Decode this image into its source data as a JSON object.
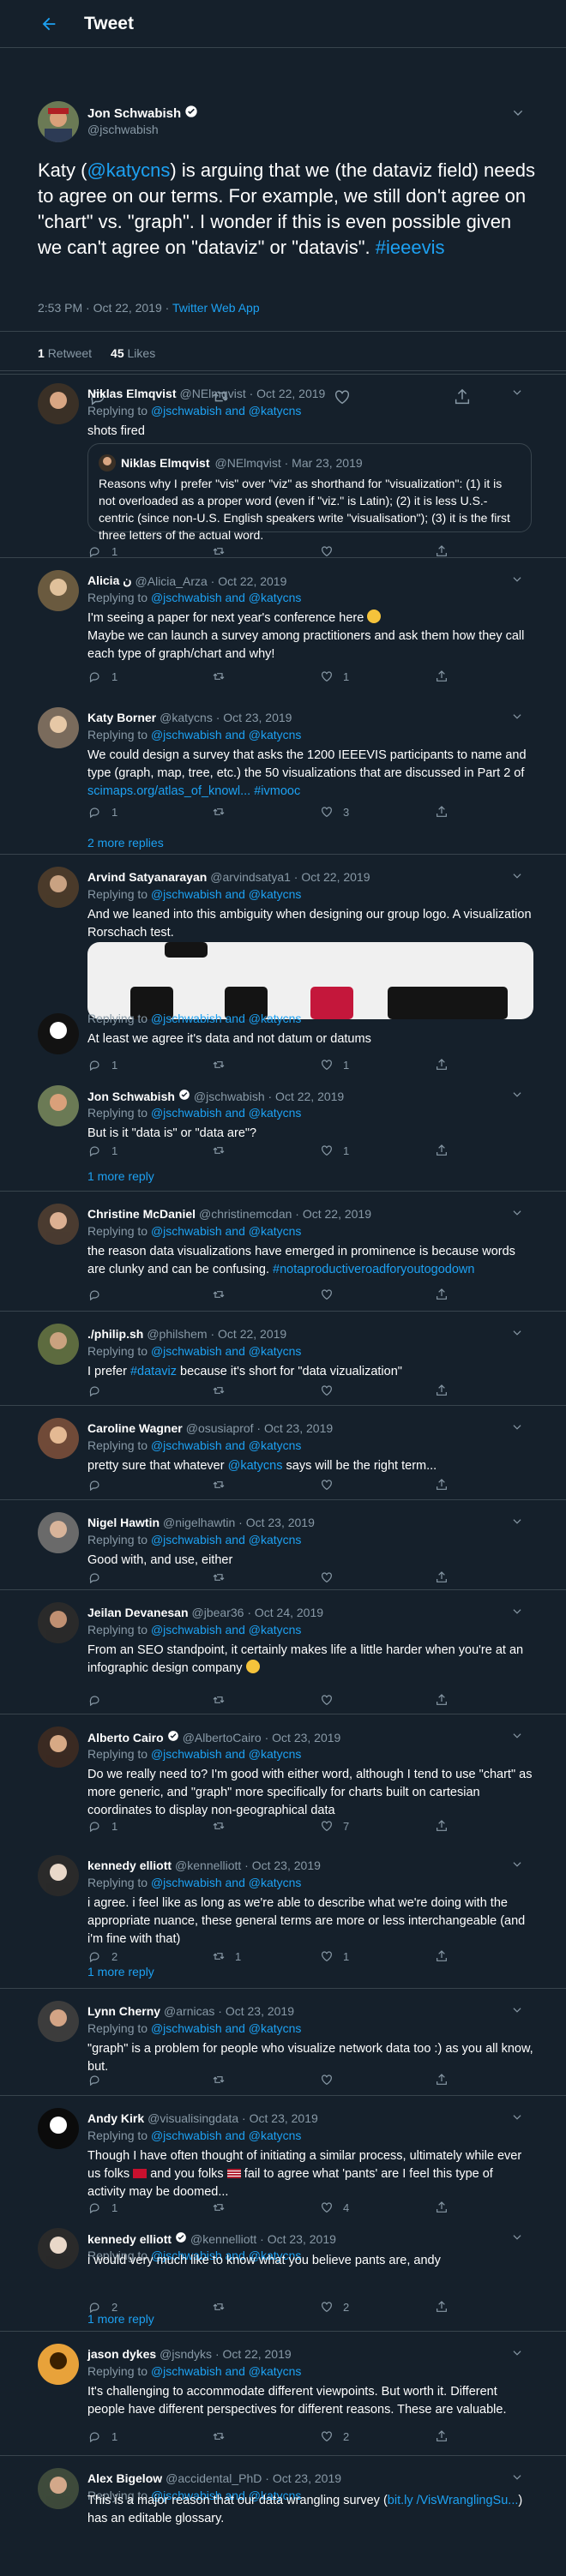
{
  "header": {
    "title": "Tweet"
  },
  "main_tweet": {
    "name": "Jon Schwabish",
    "handle": "@jschwabish",
    "text_parts": [
      {
        "t": "Katy (",
        "link": false
      },
      {
        "t": "@katycns",
        "link": true
      },
      {
        "t": ") is arguing that we (the dataviz field) needs to agree on our terms. For example, we still don't agree on \"chart\" vs. \"graph\". I wonder if this is even possible given we can't agree on \"dataviz\" or \"datavis\". ",
        "link": false
      },
      {
        "t": "#ieeevis",
        "link": true
      }
    ],
    "time": "2:53 PM · Oct 22, 2019 · ",
    "source": "Twitter Web App",
    "retweets": "1",
    "retweets_label": "Retweet",
    "likes": "45",
    "likes_label": "Likes"
  },
  "reply_prefix": "Replying to ",
  "reply_targets": "@jschwabish and @katycns",
  "replies": [
    {
      "name": "Niklas Elmqvist",
      "handle": "@NElmqvist · Oct 22, 2019",
      "body": "shots fired",
      "counts": [
        "1",
        "",
        "",
        ""
      ]
    },
    {
      "name": "Alicia ن",
      "handle": "@Alicia_Arza · Oct 22, 2019",
      "body": "I'm seeing a paper for next year's conference here",
      "body2": "Maybe we can launch a survey among practitioners and ask them how they call each type of graph/chart and why!",
      "counts": [
        "1",
        "",
        "1",
        ""
      ]
    },
    {
      "name": "Katy Borner",
      "handle": "@katycns · Oct 23, 2019",
      "body": "We could design a survey that asks the 1200 IEEEVIS participants to name and type (graph, map, tree, etc.) the 50 visualizations that are discussed in Part 2 of ",
      "link": "scimaps.org/atlas_of_knowl... #ivmooc",
      "counts": [
        "1",
        "",
        "3",
        ""
      ]
    },
    {
      "name": "Arvind Satyanarayan",
      "handle": "@arvindsatya1 · Oct 22, 2019",
      "body": "And we leaned into this ambiguity when designing our group logo. A visualization Rorschach test.",
      "counts": [
        "",
        "",
        "",
        ""
      ]
    },
    {
      "name": "",
      "handle": "",
      "body": "At least we agree it's data and not datum or datums",
      "counts": [
        "1",
        "",
        "1",
        ""
      ]
    },
    {
      "name": "Jon Schwabish",
      "handle": "@jschwabish · Oct 22, 2019",
      "body": "But is it \"data is\" or \"data are\"?",
      "counts": [
        "1",
        "",
        "1",
        ""
      ]
    },
    {
      "name": "Christine McDaniel",
      "handle": "@christinemcdan · Oct 22, 2019",
      "body": "the reason data visualizations have emerged in prominence is because words are clunky and can be confusing. ",
      "link": "#notaproductiveroadforyoutogodown",
      "counts": [
        "",
        "",
        "",
        ""
      ]
    },
    {
      "name": "./philip.sh",
      "handle": "@philshem · Oct 22, 2019",
      "body": "I prefer ",
      "link": "#dataviz",
      "body_after": " because it's short for \"data vizualization\"",
      "counts": [
        "",
        "",
        "",
        ""
      ]
    },
    {
      "name": "Caroline Wagner",
      "handle": "@osusiaprof · Oct 23, 2019",
      "body": "pretty sure that whatever ",
      "link": "@katycns",
      "body_after": " says will be the right term...",
      "counts": [
        "",
        "",
        "",
        ""
      ]
    },
    {
      "name": "Nigel Hawtin",
      "handle": "@nigelhawtin · Oct 23, 2019",
      "body": "Good with, and use, either",
      "counts": [
        "",
        "",
        "",
        ""
      ]
    },
    {
      "name": "Jeilan Devanesan",
      "handle": "@jbear36 · Oct 24, 2019",
      "body": "From an SEO standpoint, it certainly makes life a little harder when you're at an infographic design company",
      "counts": [
        "",
        "",
        "",
        ""
      ]
    },
    {
      "name": "Alberto Cairo",
      "handle": "@AlbertoCairo · Oct 23, 2019",
      "body": "Do we really need to? I'm good with either word, although I tend to use \"chart\" as more generic, and \"graph\" more specifically for charts built on cartesian coordinates to display non-geographical data",
      "counts": [
        "1",
        "",
        "7",
        ""
      ]
    },
    {
      "name": "kennedy elliott",
      "handle": "@kennelliott · Oct 23, 2019",
      "body": "i agree. i feel like as long as we're able to describe what we're doing with the appropriate nuance, these general terms are more or less interchangeable (and i'm fine with that)",
      "counts": [
        "2",
        "1",
        "1",
        ""
      ]
    },
    {
      "name": "Lynn Cherny",
      "handle": "@arnicas · Oct 23, 2019",
      "body": "\"graph\" is a problem for people who visualize network data too :) as you all know, but.",
      "counts": [
        "",
        "",
        "",
        ""
      ]
    },
    {
      "name": "Andy Kirk",
      "handle": "@visualisingdata · Oct 23, 2019",
      "body": "Though I have often thought of initiating a similar process, ultimately while ever us folks",
      "body_mid": "and you folks",
      "body_after": "fail to agree what 'pants' are I feel this type of activity may be doomed...",
      "counts": [
        "1",
        "",
        "4",
        ""
      ]
    },
    {
      "name": "kennedy elliott",
      "handle": "@kennelliott · Oct 23, 2019",
      "body": "i would very much like to know what you believe pants are, andy",
      "counts": [
        "2",
        "",
        "2",
        ""
      ]
    },
    {
      "name": "jason dykes",
      "handle": "@jsndyks · Oct 22, 2019",
      "body": "It's challenging to accommodate different viewpoints. But worth it. Different people have different perspectives for different reasons. These are valuable.",
      "counts": [
        "1",
        "",
        "2",
        ""
      ]
    },
    {
      "name": "Alex Bigelow",
      "handle": "@accidental_PhD · Oct 23, 2019",
      "body": "This is a major reason that our data wrangling survey (",
      "link": "bit.ly /VisWranglingSu...",
      "body_after": ") has an editable glossary.",
      "counts": [
        "",
        "",
        "",
        ""
      ]
    }
  ],
  "quote": {
    "name": "Niklas Elmqvist",
    "handle": "@NElmqvist · Mar 23, 2019",
    "body": "Reasons why I prefer \"vis\" over \"viz\" as shorthand for \"visualization\": (1) it is not overloaded as a proper word (even if \"viz.\" is Latin); (2) it is less U.S.-centric (since non-U.S. English speakers write \"visualisation\"); (3) it is the first three letters of the actual word."
  },
  "more_replies": [
    "2 more replies",
    "1 more reply",
    "1 more reply",
    "1 more reply"
  ],
  "colors": {
    "bg": "#15202b",
    "border": "#38444d",
    "accent": "#1da1f2",
    "muted": "#8899a6"
  }
}
